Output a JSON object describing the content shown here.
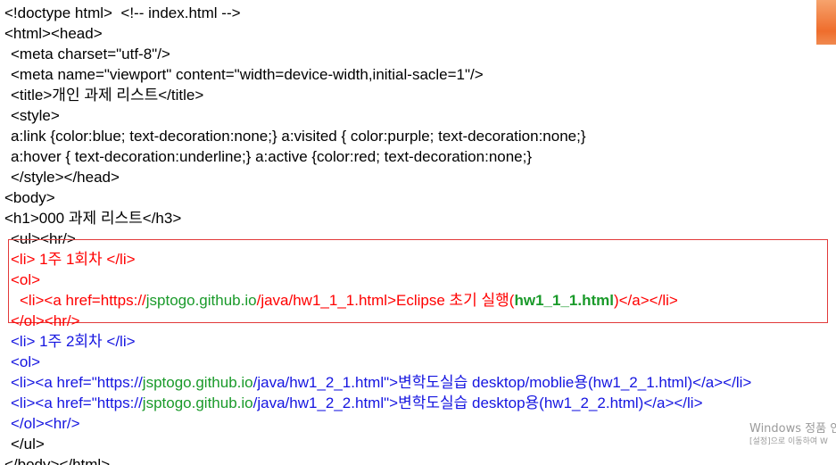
{
  "slide": {
    "accent_color": "#ef6d2c",
    "highlight_border_color": "#e23a3a"
  },
  "code": {
    "line1": "<!doctype html>  <!-- index.html -->",
    "line2": "<html><head>",
    "line3": "<meta charset=\"utf-8\"/>",
    "line4": "<meta name=\"viewport\" content=\"width=device-width,initial-sacle=1\"/>",
    "line5": "<title>개인 과제 리스트</title>",
    "line6": "<style>",
    "line7": "a:link {color:blue; text-decoration:none;} a:visited { color:purple; text-decoration:none;}",
    "line8": "a:hover { text-decoration:underline;} a:active {color:red; text-decoration:none;}",
    "line9": "</style></head>",
    "line10": "<body>",
    "line11": "<h1>000 과제 리스트</h3>",
    "line12": "<ul><hr/>",
    "line13": "<li> 1주 1회차 </li>",
    "line14": "<ol>",
    "line15": {
      "a": "<li><a href=https://",
      "b": "jsptogo.github.io",
      "c": "/java/hw1_1_1.html>Eclipse 초기 실행(",
      "d": "hw1_1_1.html",
      "e": ")</a></li>"
    },
    "line16": "</ol><hr/>",
    "line17": "<li> 1주 2회차 </li>",
    "line18": "<ol>",
    "line19": {
      "a": "<li><a href=\"https://",
      "b": "jsptogo.github.io",
      "c": "/java/hw1_2_1.html\">",
      "d": "변학도실습 desktop/moblie용(hw1_2_1.html)</a></li>"
    },
    "line20": {
      "a": "<li><a href=\"https://",
      "b": "jsptogo.github.io",
      "c": "/java/hw1_2_2.html\">",
      "d": "변학도실습 desktop용(hw1_2_2.html)</a></li>"
    },
    "line21": "</ol><hr/>",
    "line22": "</ul>",
    "line23": "</body></html>"
  },
  "watermark": {
    "title": "Windows 정품 인",
    "subtitle": "[설정]으로 이동하여 W"
  }
}
